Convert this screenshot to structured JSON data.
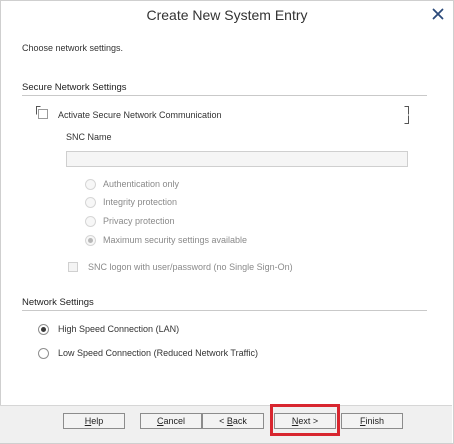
{
  "dialog": {
    "title": "Create New System Entry",
    "intro": "Choose network settings."
  },
  "secure_network": {
    "section_title": "Secure Network Settings",
    "activate_label": "Activate Secure Network Communication",
    "activate_checked": false,
    "snc_name_label": "SNC Name",
    "snc_name_value": "",
    "protection_options": [
      {
        "label": "Authentication only",
        "selected": false,
        "enabled": false
      },
      {
        "label": "Integrity protection",
        "selected": false,
        "enabled": false
      },
      {
        "label": "Privacy protection",
        "selected": false,
        "enabled": false
      },
      {
        "label": "Maximum security settings available",
        "selected": true,
        "enabled": false
      }
    ],
    "snc_logon_label": "SNC logon with user/password (no Single Sign-On)",
    "snc_logon_checked": false
  },
  "network": {
    "section_title": "Network Settings",
    "options": [
      {
        "label": "High Speed Connection (LAN)",
        "selected": true
      },
      {
        "label": "Low Speed Connection (Reduced Network Traffic)",
        "selected": false
      }
    ]
  },
  "buttons": {
    "help": {
      "mnemonic": "H",
      "rest": "elp"
    },
    "cancel": {
      "mnemonic": "C",
      "rest": "ancel"
    },
    "back": {
      "prefix": "< ",
      "mnemonic": "B",
      "rest": "ack"
    },
    "next": {
      "mnemonic": "N",
      "rest": "ext >"
    },
    "finish": {
      "mnemonic": "F",
      "rest": "inish"
    }
  },
  "colors": {
    "highlight": "#d8262f",
    "footer_bg": "#f0f0f0"
  }
}
